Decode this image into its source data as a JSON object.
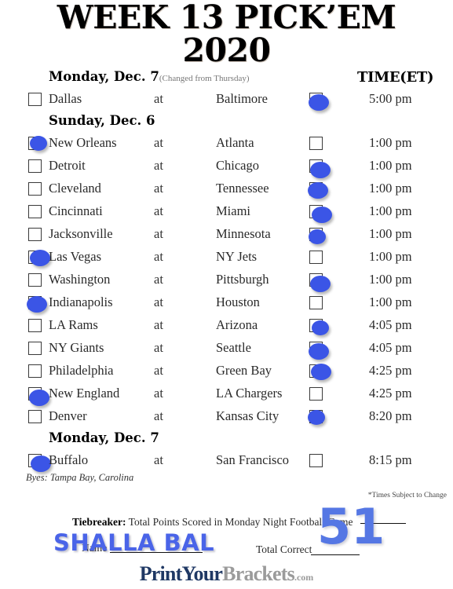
{
  "title": {
    "line1": "WEEK 13 PICK’EM",
    "line2": "2020"
  },
  "colors": {
    "pick_blue": "#3b55e6",
    "signature_blue": "#4a64e8",
    "answer_blue": "#5577e4",
    "brand_navy": "#1f3864",
    "brand_gray": "#9b9b9b"
  },
  "header": {
    "time_column": "TIME(ET)",
    "at_word": "at"
  },
  "sections": [
    {
      "day_label": "Monday, Dec. 7",
      "day_note": "(Changed from Thursday)",
      "games": [
        {
          "away": "Dallas",
          "home": "Baltimore",
          "time": "5:00 pm",
          "away_picked": false,
          "home_picked": true
        }
      ]
    },
    {
      "day_label": "Sunday, Dec. 6",
      "day_note": "",
      "games": [
        {
          "away": "New Orleans",
          "home": "Atlanta",
          "time": "1:00 pm",
          "away_picked": true,
          "home_picked": false
        },
        {
          "away": "Detroit",
          "home": "Chicago",
          "time": "1:00 pm",
          "away_picked": false,
          "home_picked": true
        },
        {
          "away": "Cleveland",
          "home": "Tennessee",
          "time": "1:00 pm",
          "away_picked": false,
          "home_picked": true
        },
        {
          "away": "Cincinnati",
          "home": "Miami",
          "time": "1:00 pm",
          "away_picked": false,
          "home_picked": true
        },
        {
          "away": "Jacksonville",
          "home": "Minnesota",
          "time": "1:00 pm",
          "away_picked": false,
          "home_picked": true
        },
        {
          "away": "Las Vegas",
          "home": "NY Jets",
          "time": "1:00 pm",
          "away_picked": true,
          "home_picked": false
        },
        {
          "away": "Washington",
          "home": "Pittsburgh",
          "time": "1:00 pm",
          "away_picked": false,
          "home_picked": true
        },
        {
          "away": "Indianapolis",
          "home": "Houston",
          "time": "1:00 pm",
          "away_picked": true,
          "home_picked": false
        },
        {
          "away": "LA Rams",
          "home": "Arizona",
          "time": "4:05 pm",
          "away_picked": false,
          "home_picked": true
        },
        {
          "away": "NY Giants",
          "home": "Seattle",
          "time": "4:05 pm",
          "away_picked": false,
          "home_picked": true
        },
        {
          "away": "Philadelphia",
          "home": "Green Bay",
          "time": "4:25 pm",
          "away_picked": false,
          "home_picked": true
        },
        {
          "away": "New England",
          "home": "LA Chargers",
          "time": "4:25 pm",
          "away_picked": true,
          "home_picked": false
        },
        {
          "away": "Denver",
          "home": "Kansas City",
          "time": "8:20 pm",
          "away_picked": false,
          "home_picked": true
        }
      ]
    },
    {
      "day_label": "Monday, Dec. 7",
      "day_note": "",
      "games": [
        {
          "away": "Buffalo",
          "home": "San Francisco",
          "time": "8:15 pm",
          "away_picked": true,
          "home_picked": false
        }
      ]
    }
  ],
  "footer": {
    "byes": "Byes: Tampa Bay, Carolina",
    "times_note": "*Times Subject to Change",
    "tiebreaker_label": "Tiebreaker:",
    "tiebreaker_text": "Total Points Scored in Monday Night Football Game",
    "tiebreaker_answer": "51",
    "name_label": "Name",
    "signature": "SHALLA BAL",
    "total_correct_label": "Total Correct",
    "total_correct_value": "",
    "brand_part1": "PrintYour",
    "brand_part2": "Brackets",
    "brand_part3": ".com"
  }
}
